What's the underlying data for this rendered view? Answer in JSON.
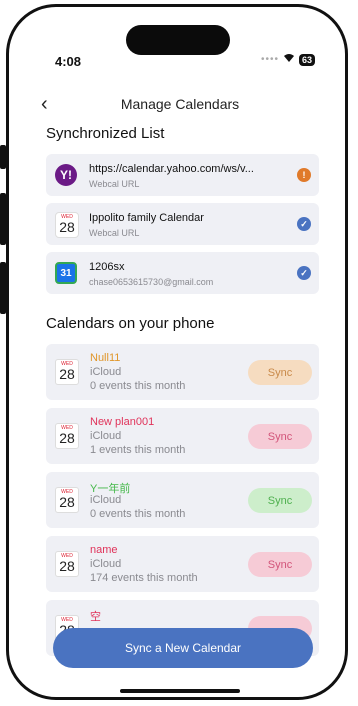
{
  "status": {
    "time": "4:08",
    "battery": "63"
  },
  "nav": {
    "back": "‹",
    "title": "Manage Calendars"
  },
  "synced": {
    "title": "Synchronized List",
    "items": [
      {
        "title": "https://calendar.yahoo.com/ws/v...",
        "subtitle": "Webcal URL",
        "icon": "yahoo-icon",
        "icon_text": "Y!",
        "status": "!",
        "status_color": "#e07a2a"
      },
      {
        "title": "Ippolito family Calendar",
        "subtitle": "Webcal URL",
        "icon": "calendar-icon",
        "icon_wed": "WED",
        "icon_num": "28",
        "status": "✓",
        "status_color": "#4a73c1"
      },
      {
        "title": "1206sx",
        "subtitle": "chase0653615730@gmail.com",
        "icon": "google-calendar-icon",
        "icon_text": "31",
        "status": "✓",
        "status_color": "#4a73c1"
      }
    ]
  },
  "phone": {
    "title": "Calendars on your phone",
    "items": [
      {
        "name": "Null11",
        "name_color": "#e0962a",
        "source": "iCloud",
        "count": "0 events this month",
        "wed": "WED",
        "num": "28",
        "sync": "Sync",
        "sync_bg": "#f6dcc0",
        "sync_fg": "#c98a4a"
      },
      {
        "name": "New plan001",
        "name_color": "#e0335a",
        "source": "iCloud",
        "count": "1 events this month",
        "wed": "WED",
        "num": "28",
        "sync": "Sync",
        "sync_bg": "#f6cbd6",
        "sync_fg": "#d2557a"
      },
      {
        "name": "Y一年前",
        "name_color": "#45b84a",
        "source": "iCloud",
        "count": "0 events this month",
        "wed": "WED",
        "num": "28",
        "sync": "Sync",
        "sync_bg": "#cdeecb",
        "sync_fg": "#4fb04f"
      },
      {
        "name": "name",
        "name_color": "#e0335a",
        "source": "iCloud",
        "count": "174 events this month",
        "wed": "WED",
        "num": "28",
        "sync": "Sync",
        "sync_bg": "#f6cbd6",
        "sync_fg": "#d2557a"
      },
      {
        "name": "空",
        "name_color": "#e0335a",
        "source": "",
        "count": "",
        "wed": "WED",
        "num": "28",
        "sync": "",
        "sync_bg": "#f6cbd6",
        "sync_fg": "#d2557a"
      }
    ]
  },
  "bottom": {
    "label": "Sync a New Calendar"
  }
}
